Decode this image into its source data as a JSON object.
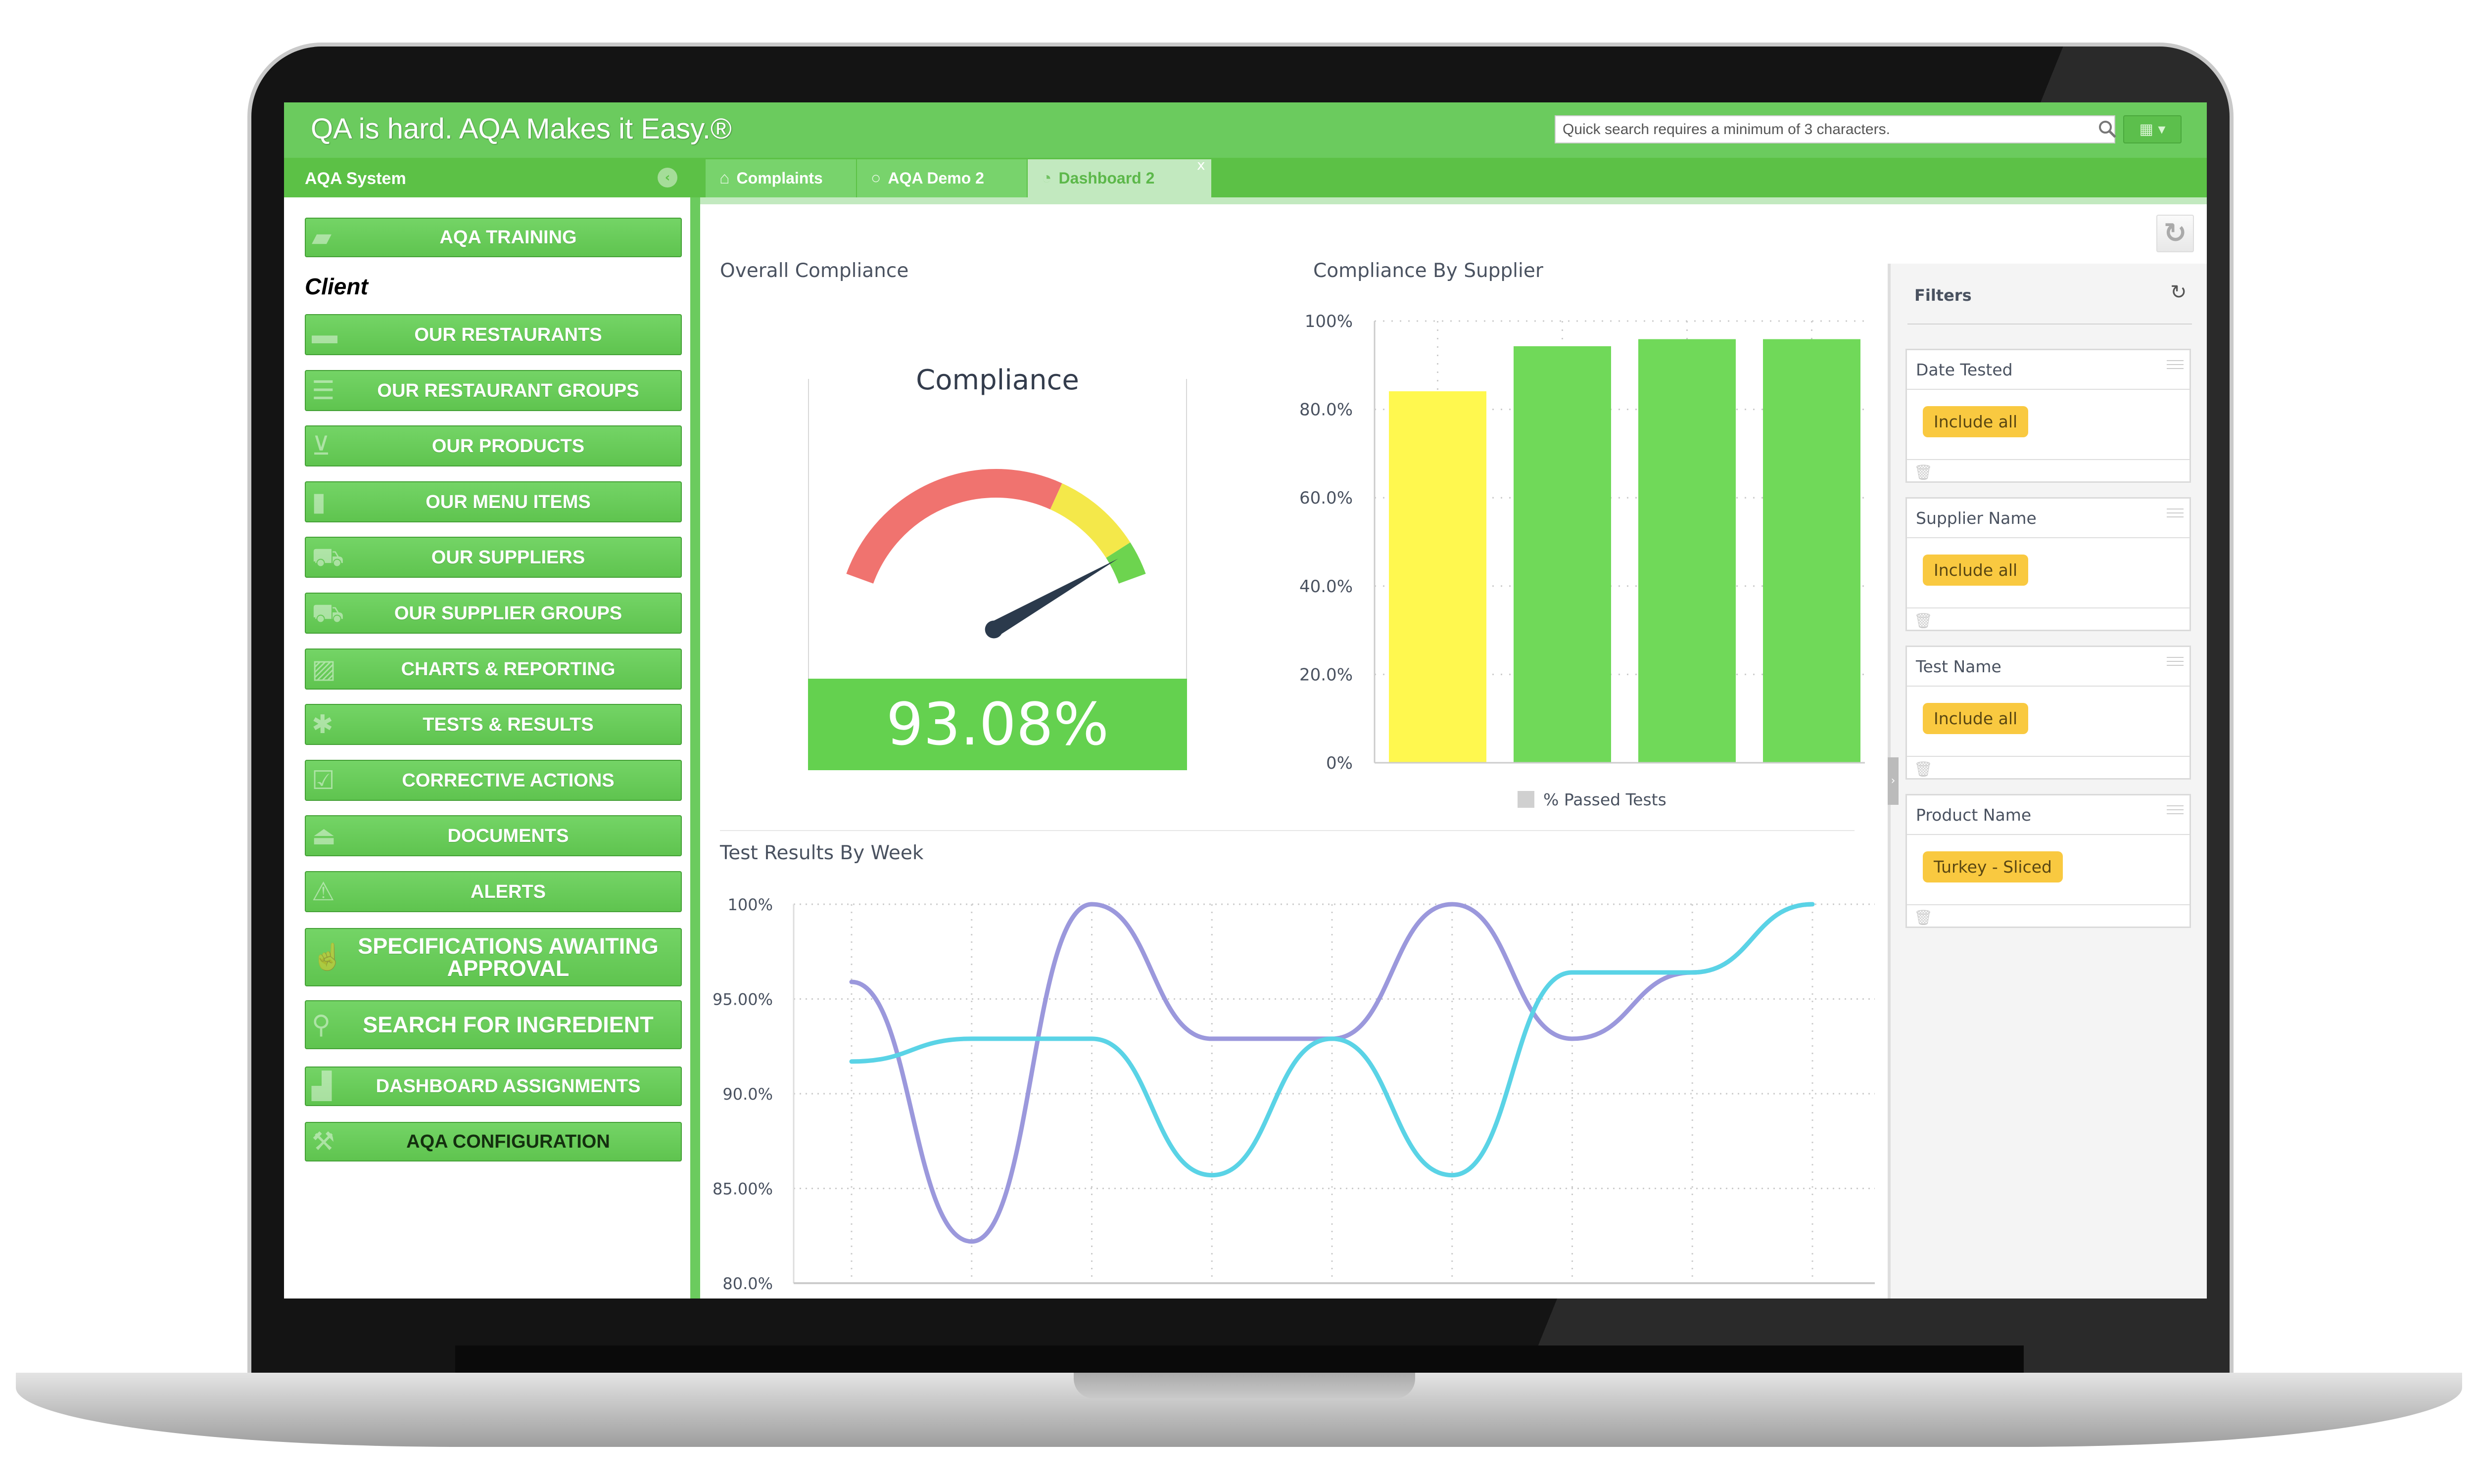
{
  "app": {
    "title": "QA is hard. AQA Makes it Easy.®",
    "search_placeholder": "Quick search requires a minimum of 3 characters.",
    "grid_menu": "▾",
    "accent": "#6bcb5e"
  },
  "sidebar": {
    "title": "AQA System",
    "section_label": "Client",
    "items": [
      {
        "label": "AQA TRAINING",
        "icon": "book-icon"
      },
      {
        "label": "OUR RESTAURANTS",
        "icon": "minus-icon"
      },
      {
        "label": "OUR RESTAURANT GROUPS",
        "icon": "list-icon"
      },
      {
        "label": "OUR PRODUCTS",
        "icon": "cart-icon"
      },
      {
        "label": "OUR MENU ITEMS",
        "icon": "menu-card-icon"
      },
      {
        "label": "OUR SUPPLIERS",
        "icon": "truck-icon"
      },
      {
        "label": "OUR SUPPLIER GROUPS",
        "icon": "truck-plus-icon"
      },
      {
        "label": "CHARTS & REPORTING",
        "icon": "image-icon"
      },
      {
        "label": "TESTS & RESULTS",
        "icon": "asterisk-icon"
      },
      {
        "label": "CORRECTIVE ACTIONS",
        "icon": "checkbox-icon"
      },
      {
        "label": "DOCUMENTS",
        "icon": "inbox-icon"
      },
      {
        "label": "ALERTS",
        "icon": "warning-icon"
      },
      {
        "label": "SPECIFICATIONS AWAITING APPROVAL",
        "icon": "thumbs-up-icon"
      },
      {
        "label": "SEARCH FOR INGREDIENT",
        "icon": "search-icon"
      },
      {
        "label": "DASHBOARD ASSIGNMENTS",
        "icon": "bar-chart-icon"
      },
      {
        "label": "AQA CONFIGURATION",
        "icon": "wrench-icon"
      }
    ]
  },
  "tabs": [
    {
      "label": "Complaints",
      "icon": "home-icon"
    },
    {
      "label": "AQA Demo 2",
      "icon": "circle-icon"
    },
    {
      "label": "Dashboard 2",
      "icon": "dashboard-icon",
      "active": true,
      "close": "x"
    }
  ],
  "dashboard": {
    "overall": {
      "title": "Overall Compliance",
      "gauge_title": "Compliance",
      "value": 93.08,
      "value_label": "93.08%",
      "range": [
        0,
        100
      ],
      "bands": [
        {
          "from": 0,
          "to": 67.5,
          "color": "#f0736f"
        },
        {
          "from": 67.5,
          "to": 91,
          "color": "#f4e84a"
        },
        {
          "from": 91,
          "to": 100,
          "color": "#6dd44f"
        }
      ],
      "value_color": "#64d14f"
    },
    "supplier_title": "Compliance By Supplier",
    "weekly_title": "Test Results By Week"
  },
  "chart_data": [
    {
      "type": "bar",
      "title": "Compliance By Supplier",
      "values": [
        84.1,
        94.3,
        95.9,
        95.9
      ],
      "bar_colors": [
        "#fff84f",
        "#70d959",
        "#70d959",
        "#70d959"
      ],
      "yticks": [
        "0%",
        "20.0%",
        "40.0%",
        "60.0%",
        "80.0%",
        "100%"
      ],
      "ylim": [
        0,
        100
      ],
      "grid": true,
      "legend": {
        "label": "% Passed Tests",
        "color": "#d0d0d0",
        "position": "bottom"
      }
    },
    {
      "type": "line",
      "title": "Test Results By Week",
      "x": [
        1,
        2,
        3,
        4,
        5,
        6,
        7,
        8,
        9
      ],
      "series": [
        {
          "color": "#9b98dc",
          "values": [
            95.9,
            82.2,
            100,
            92.9,
            92.9,
            100,
            92.9,
            96.4,
            100
          ]
        },
        {
          "color": "#5ad3e6",
          "values": [
            91.7,
            92.9,
            92.9,
            85.7,
            92.9,
            85.7,
            96.4,
            96.4,
            100
          ]
        }
      ],
      "yticks": [
        "80.0%",
        "85.00%",
        "90.0%",
        "95.00%",
        "100%"
      ],
      "ylim": [
        80,
        100
      ],
      "grid": true,
      "smooth": true
    }
  ],
  "filters": {
    "title": "Filters",
    "reset_icon": "↻",
    "items": [
      {
        "name": "Date Tested",
        "value": "Include all"
      },
      {
        "name": "Supplier Name",
        "value": "Include all"
      },
      {
        "name": "Test Name",
        "value": "Include all"
      },
      {
        "name": "Product Name",
        "value": "Turkey - Sliced"
      }
    ],
    "badge_color": "#f9c940"
  }
}
